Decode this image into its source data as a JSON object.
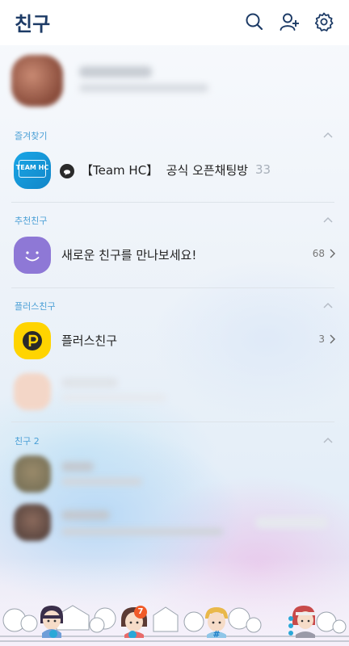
{
  "header": {
    "title": "친구",
    "icons": [
      "search-icon",
      "add-friend-icon",
      "settings-icon"
    ]
  },
  "sections": {
    "favorites": {
      "label": "즐겨찾기",
      "item": {
        "logo_text": "TEAM HC",
        "prefix": "【Team HC】",
        "title": "공식 오픈채팅방",
        "count": "33"
      }
    },
    "recommended": {
      "label": "추천친구",
      "item": {
        "title": "새로운 친구를 만나보세요!",
        "count": "68"
      }
    },
    "plus": {
      "label": "플러스친구",
      "item": {
        "title": "플러스친구",
        "count": "3"
      }
    },
    "friends": {
      "label": "친구 2"
    }
  },
  "tab_bar": {
    "badge_count": "7",
    "icons": [
      "friends-tab-icon",
      "chats-tab-icon",
      "search-tab-icon",
      "more-tab-icon"
    ]
  },
  "colors": {
    "title": "#1d3b66",
    "section_label": "#4a9fd6",
    "plus_yellow": "#ffd400",
    "recommend_purple": "#8e78d6",
    "badge": "#f05a28"
  }
}
